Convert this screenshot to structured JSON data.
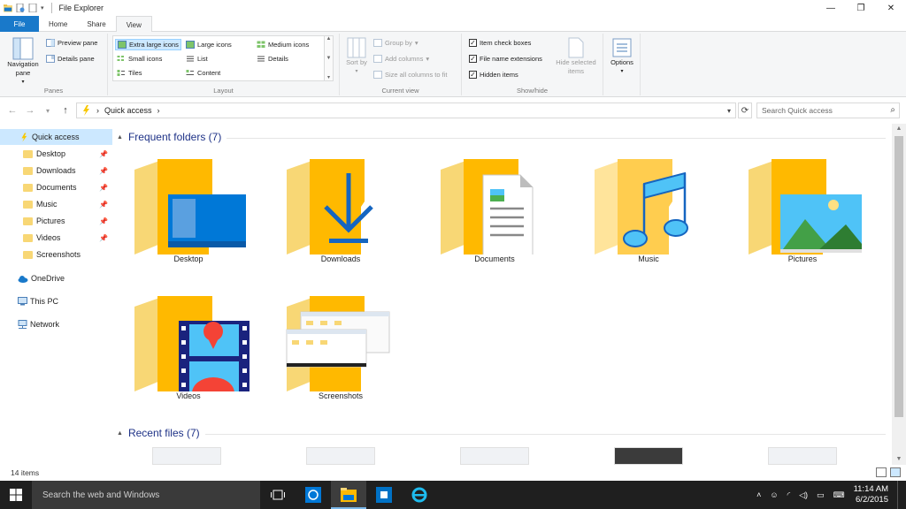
{
  "window": {
    "title": "File Explorer",
    "controls": {
      "minimize": "—",
      "maximize": "❐",
      "close": "✕"
    }
  },
  "ribbon_tabs": [
    {
      "label": "File"
    },
    {
      "label": "Home"
    },
    {
      "label": "Share"
    },
    {
      "label": "View"
    }
  ],
  "ribbon": {
    "panes": {
      "navigation_pane": "Navigation pane",
      "preview_pane": "Preview pane",
      "details_pane": "Details pane",
      "group_label": "Panes"
    },
    "layout": {
      "options": [
        "Extra large icons",
        "Large icons",
        "Medium icons",
        "Small icons",
        "List",
        "Details",
        "Tiles",
        "Content"
      ],
      "selected": "Extra large icons",
      "group_label": "Layout"
    },
    "current_view": {
      "sort_by": "Sort by",
      "group_by": "Group by",
      "add_columns": "Add columns",
      "size_columns": "Size all columns to fit",
      "group_label": "Current view"
    },
    "show_hide": {
      "item_check_boxes": "Item check boxes",
      "file_name_extensions": "File name extensions",
      "hidden_items": "Hidden items",
      "hide_selected": "Hide selected items",
      "options": "Options",
      "group_label": "Show/hide",
      "checked": {
        "item_check_boxes": true,
        "file_name_extensions": true,
        "hidden_items": true
      }
    }
  },
  "address": {
    "path": "Quick access",
    "separator": "›",
    "search_placeholder": "Search Quick access"
  },
  "sidebar": {
    "items": [
      {
        "label": "Quick access",
        "icon": "star-icon",
        "selected": true
      },
      {
        "label": "Desktop",
        "icon": "folder-icon",
        "pinned": true
      },
      {
        "label": "Downloads",
        "icon": "download-icon",
        "pinned": true
      },
      {
        "label": "Documents",
        "icon": "folder-icon",
        "pinned": true
      },
      {
        "label": "Music",
        "icon": "music-icon",
        "pinned": true
      },
      {
        "label": "Pictures",
        "icon": "folder-icon",
        "pinned": true
      },
      {
        "label": "Videos",
        "icon": "folder-icon",
        "pinned": true
      },
      {
        "label": "Screenshots",
        "icon": "folder-icon"
      },
      {
        "label": "OneDrive",
        "icon": "cloud-icon"
      },
      {
        "label": "This PC",
        "icon": "computer-icon"
      },
      {
        "label": "Network",
        "icon": "network-icon"
      }
    ]
  },
  "main": {
    "frequent_header": "Frequent folders (7)",
    "recent_header": "Recent files (7)",
    "folders": [
      {
        "label": "Desktop"
      },
      {
        "label": "Downloads"
      },
      {
        "label": "Documents"
      },
      {
        "label": "Music"
      },
      {
        "label": "Pictures"
      },
      {
        "label": "Videos"
      },
      {
        "label": "Screenshots"
      }
    ]
  },
  "status": {
    "item_count": "14 items"
  },
  "taskbar": {
    "search_placeholder": "Search the web and Windows",
    "time": "11:14 AM",
    "date": "6/2/2015"
  },
  "colors": {
    "accent": "#1979ca",
    "folder_back": "#f8d775",
    "folder_front": "#ffb900",
    "selection": "#cce8ff",
    "header_text": "#1e3287"
  }
}
